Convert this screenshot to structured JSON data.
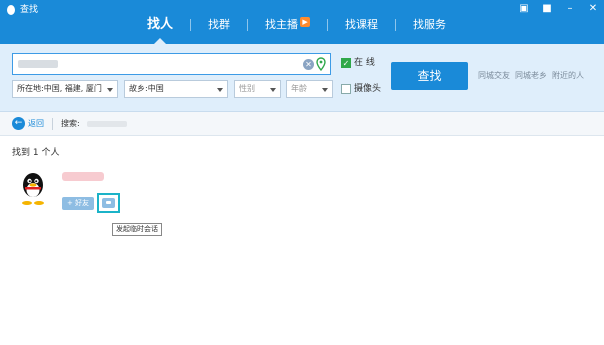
{
  "window": {
    "title": "查找",
    "controls": [
      "gift-icon",
      "lock-icon",
      "minimize-icon",
      "close-icon"
    ]
  },
  "tabs": [
    {
      "label": "找人",
      "active": true
    },
    {
      "label": "找群",
      "active": false
    },
    {
      "label": "找主播",
      "active": false,
      "badge": true
    },
    {
      "label": "找课程",
      "active": false
    },
    {
      "label": "找服务",
      "active": false
    }
  ],
  "search": {
    "keyword_value": "",
    "online_label": "在 线",
    "online_checked": true,
    "camera_label": "摄像头",
    "camera_checked": false,
    "location_select": "所在地:中国, 福建, 厦门",
    "hometown_select": "故乡:中国",
    "gender_select": "性别",
    "age_select": "年龄",
    "search_button": "查找",
    "quick_links": [
      "同城交友",
      "同城老乡",
      "附近的人"
    ]
  },
  "breadcrumb": {
    "back_label": "返回",
    "search_prefix": "搜索:"
  },
  "results": {
    "count_text": "找到 1 个人",
    "add_friend_label": "+ 好友",
    "chat_tooltip": "发起临时会话"
  },
  "colors": {
    "brand_blue": "#1a8ad8",
    "panel_bg": "#dfeefb",
    "check_green": "#2fa84a",
    "highlight_teal": "#1bb3c8"
  }
}
